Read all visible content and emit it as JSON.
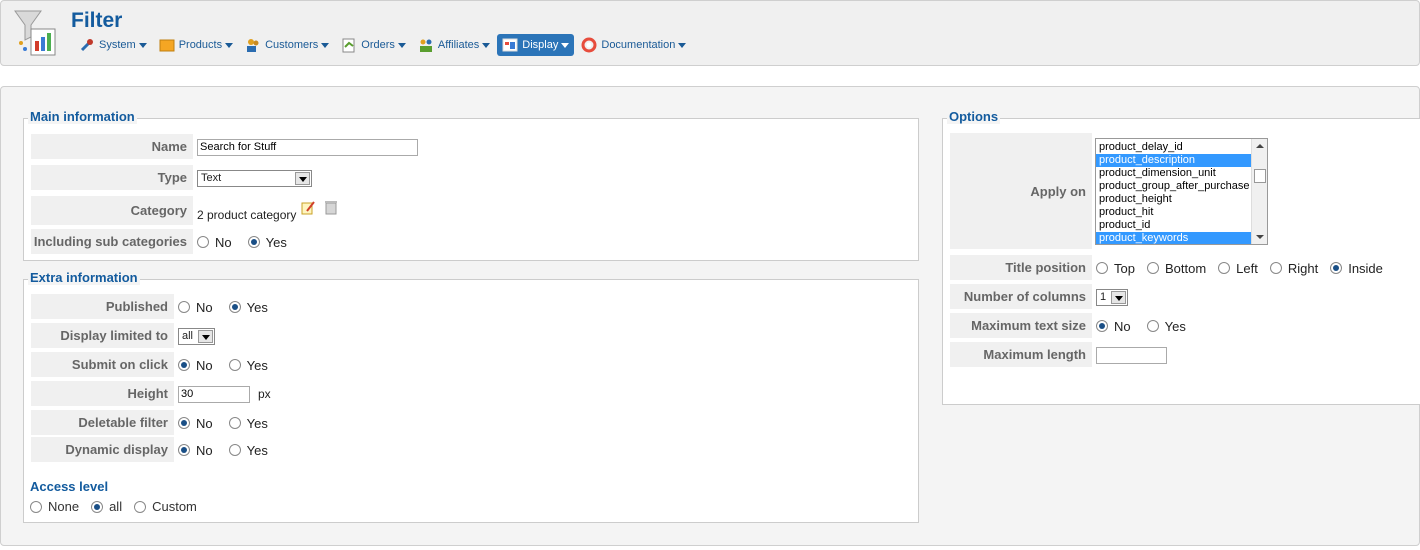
{
  "header": {
    "title": "Filter",
    "menu": [
      {
        "label": "System",
        "icon": "tools-icon"
      },
      {
        "label": "Products",
        "icon": "box-icon"
      },
      {
        "label": "Customers",
        "icon": "users-icon"
      },
      {
        "label": "Orders",
        "icon": "orders-icon"
      },
      {
        "label": "Affiliates",
        "icon": "affiliates-icon"
      },
      {
        "label": "Display",
        "icon": "display-icon",
        "active": true
      },
      {
        "label": "Documentation",
        "icon": "lifebuoy-icon"
      }
    ]
  },
  "main_info": {
    "legend": "Main information",
    "name_label": "Name",
    "name_value": "Search for Stuff",
    "type_label": "Type",
    "type_value": "Text",
    "category_label": "Category",
    "category_value": "2 product category",
    "subcat_label": "Including sub categories",
    "no": "No",
    "yes": "Yes"
  },
  "extra_info": {
    "legend": "Extra information",
    "published_label": "Published",
    "display_limited_label": "Display limited to",
    "display_limited_value": "all",
    "submit_label": "Submit on click",
    "height_label": "Height",
    "height_value": "30",
    "height_unit": "px",
    "deletable_label": "Deletable filter",
    "dynamic_label": "Dynamic display",
    "no": "No",
    "yes": "Yes",
    "access_title": "Access level",
    "access_none": "None",
    "access_all": "all",
    "access_custom": "Custom"
  },
  "options": {
    "legend": "Options",
    "apply_label": "Apply on",
    "apply_options": [
      {
        "label": "product_delay_id",
        "selected": false
      },
      {
        "label": "product_description",
        "selected": true
      },
      {
        "label": "product_dimension_unit",
        "selected": false
      },
      {
        "label": "product_group_after_purchase",
        "selected": false
      },
      {
        "label": "product_height",
        "selected": false
      },
      {
        "label": "product_hit",
        "selected": false
      },
      {
        "label": "product_id",
        "selected": false
      },
      {
        "label": "product_keywords",
        "selected": true
      }
    ],
    "title_position_label": "Title position",
    "pos_top": "Top",
    "pos_bottom": "Bottom",
    "pos_left": "Left",
    "pos_right": "Right",
    "pos_inside": "Inside",
    "columns_label": "Number of columns",
    "columns_value": "1",
    "max_text_label": "Maximum text size",
    "max_length_label": "Maximum length",
    "no": "No",
    "yes": "Yes"
  }
}
